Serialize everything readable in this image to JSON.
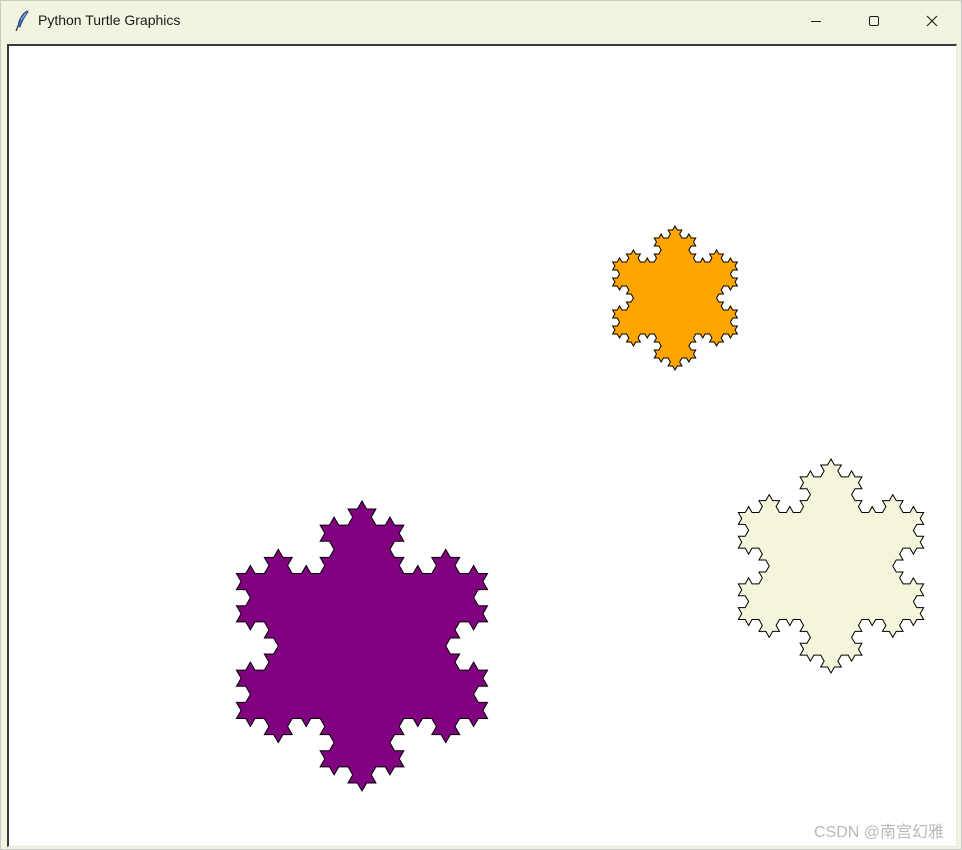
{
  "window": {
    "title": "Python Turtle Graphics",
    "icon": "feather-icon",
    "controls": {
      "minimize": "minimize-icon",
      "maximize": "maximize-icon",
      "close": "close-icon"
    }
  },
  "canvas": {
    "background": "#ffffff",
    "shapes": [
      {
        "name": "koch-snowflake-orange",
        "fill": "#ffa500",
        "stroke": "#000000",
        "level": 3
      },
      {
        "name": "koch-snowflake-beige",
        "fill": "#f5f5dc",
        "stroke": "#000000",
        "level": 3
      },
      {
        "name": "koch-snowflake-purple",
        "fill": "#800080",
        "stroke": "#000000",
        "level": 3
      }
    ]
  },
  "watermark": "CSDN @南宫幻雅"
}
